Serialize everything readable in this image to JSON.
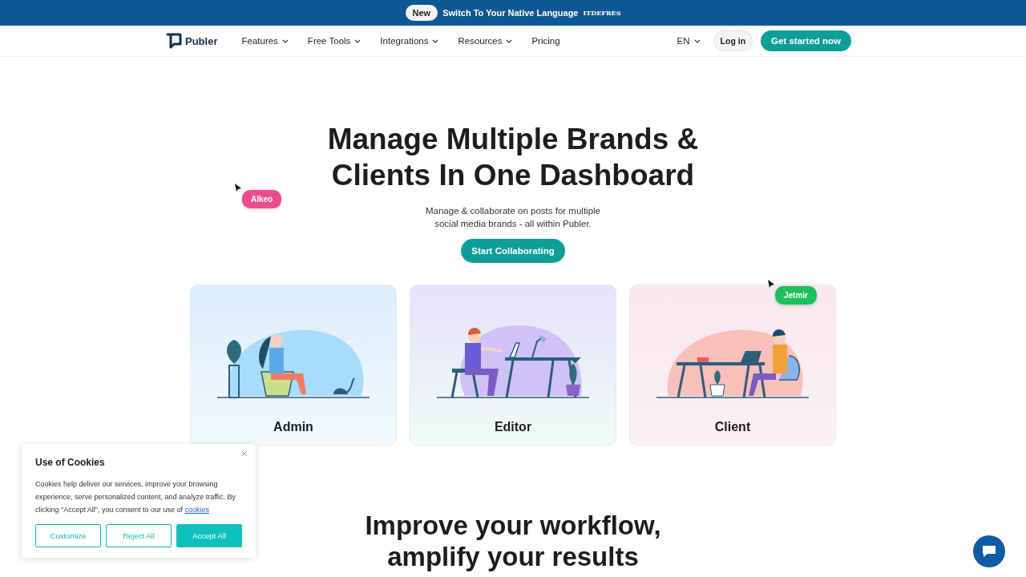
{
  "banner": {
    "badge": "New",
    "text": "Switch To Your Native Language",
    "code": "ITDEFRES"
  },
  "nav": {
    "logo": "Publer",
    "items": [
      {
        "label": "Features",
        "dropdown": true
      },
      {
        "label": "Free Tools",
        "dropdown": true
      },
      {
        "label": "Integrations",
        "dropdown": true
      },
      {
        "label": "Resources",
        "dropdown": true
      },
      {
        "label": "Pricing",
        "dropdown": false
      }
    ],
    "language": "EN",
    "login": "Log in",
    "cta": "Get started now"
  },
  "hero": {
    "title_lines": [
      "Manage Multiple Brands &",
      "Clients In One Dashboard"
    ],
    "subtitle_lines": [
      "Manage & collaborate on posts for multiple",
      "social media brands - all within Publer."
    ],
    "button": "Start Collaborating"
  },
  "cursors": [
    {
      "name": "Alkeo",
      "color": "#ec4b8c"
    },
    {
      "name": "Jetmir",
      "color": "#1ec05a"
    }
  ],
  "cards": [
    {
      "kind": "admin",
      "title": "Admin"
    },
    {
      "kind": "editor",
      "title": "Editor"
    },
    {
      "kind": "client",
      "title": "Client"
    }
  ],
  "section": {
    "title_lines": [
      "Improve your workflow,",
      "amplify your results"
    ]
  },
  "cookies": {
    "title": "Use of Cookies",
    "text": "Cookies help deliver our services, improve your browsing experience, serve personalized content, and analyze traffic. By clicking \"Accept All\", you consent to our use of",
    "link": "cookies",
    "buttons": [
      {
        "label": "Customize",
        "kind": "outline"
      },
      {
        "label": "Reject All",
        "kind": "outline"
      },
      {
        "label": "Accept All",
        "kind": "filled"
      }
    ]
  }
}
